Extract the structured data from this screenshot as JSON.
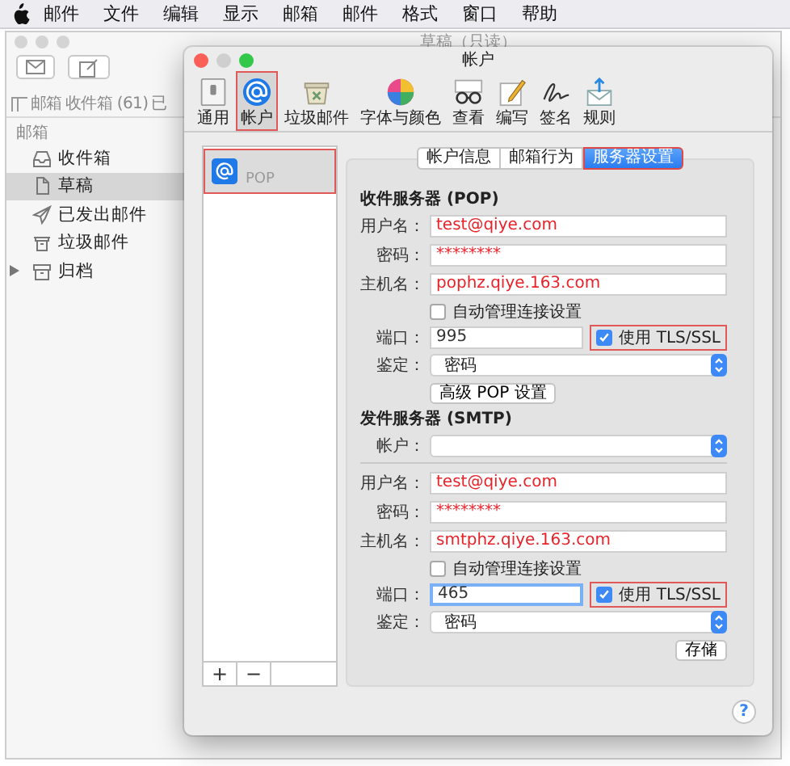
{
  "menu_bar": {
    "items": [
      "邮件",
      "文件",
      "编辑",
      "显示",
      "邮箱",
      "邮件",
      "格式",
      "窗口",
      "帮助"
    ]
  },
  "mail_window": {
    "title": "草稿（只读）",
    "tabs": [
      "邮箱",
      "收件箱 (61)",
      "已"
    ],
    "sidebar": {
      "heading": "邮箱",
      "items": [
        {
          "label": "收件箱",
          "selected": false,
          "disclosure": false
        },
        {
          "label": "草稿",
          "selected": true,
          "disclosure": false
        },
        {
          "label": "已发出邮件",
          "selected": false,
          "disclosure": false
        },
        {
          "label": "垃圾邮件",
          "selected": false,
          "disclosure": false
        },
        {
          "label": "归档",
          "selected": false,
          "disclosure": true
        }
      ]
    }
  },
  "prefs_window": {
    "title": "帐户",
    "toolbar": [
      {
        "label": "通用",
        "selected": false,
        "highlighted": false
      },
      {
        "label": "帐户",
        "selected": true,
        "highlighted": true
      },
      {
        "label": "垃圾邮件",
        "selected": false,
        "highlighted": false
      },
      {
        "label": "字体与颜色",
        "selected": false,
        "highlighted": false
      },
      {
        "label": "查看",
        "selected": false,
        "highlighted": false
      },
      {
        "label": "编写",
        "selected": false,
        "highlighted": false
      },
      {
        "label": "签名",
        "selected": false,
        "highlighted": false
      },
      {
        "label": "规则",
        "selected": false,
        "highlighted": false
      }
    ],
    "accounts": [
      {
        "label": "POP",
        "selected": true,
        "highlighted": true
      }
    ],
    "list_buttons": [
      "+",
      "−"
    ],
    "segments": [
      {
        "label": "帐户信息",
        "selected": false,
        "highlighted": false
      },
      {
        "label": "邮箱行为",
        "selected": false,
        "highlighted": false
      },
      {
        "label": "服务器设置",
        "selected": true,
        "highlighted": true
      }
    ],
    "incoming": {
      "heading": "收件服务器 (POP)",
      "rows": [
        {
          "kind": "text",
          "label": "用户名：",
          "value": "test@qiye.com"
        },
        {
          "kind": "password",
          "label": "密码：",
          "value": "********"
        },
        {
          "kind": "text",
          "label": "主机名：",
          "value": "pophz.qiye.163.com"
        },
        {
          "kind": "checkbox",
          "label": "自动管理连接设置",
          "checked": false
        },
        {
          "kind": "port",
          "label": "端口：",
          "value": "995",
          "focused": false,
          "tls": {
            "label": "使用 TLS/SSL",
            "checked": true,
            "highlighted": true
          }
        },
        {
          "kind": "select",
          "label": "鉴定：",
          "value": "密码"
        },
        {
          "kind": "button",
          "label": "高级 POP 设置"
        }
      ]
    },
    "outgoing": {
      "heading": "发件服务器 (SMTP)",
      "account": {
        "label": "帐户："
      },
      "rows": [
        {
          "kind": "text",
          "label": "用户名：",
          "value": "test@qiye.com"
        },
        {
          "kind": "password",
          "label": "密码：",
          "value": "********"
        },
        {
          "kind": "text",
          "label": "主机名：",
          "value": "smtphz.qiye.163.com"
        },
        {
          "kind": "checkbox",
          "label": "自动管理连接设置",
          "checked": false
        },
        {
          "kind": "port",
          "label": "端口：",
          "value": "465",
          "focused": true,
          "tls": {
            "label": "使用 TLS/SSL",
            "checked": true,
            "highlighted": true
          }
        },
        {
          "kind": "select",
          "label": "鉴定：",
          "value": "密码"
        }
      ],
      "save_button": "存储"
    },
    "help_button": "?"
  }
}
